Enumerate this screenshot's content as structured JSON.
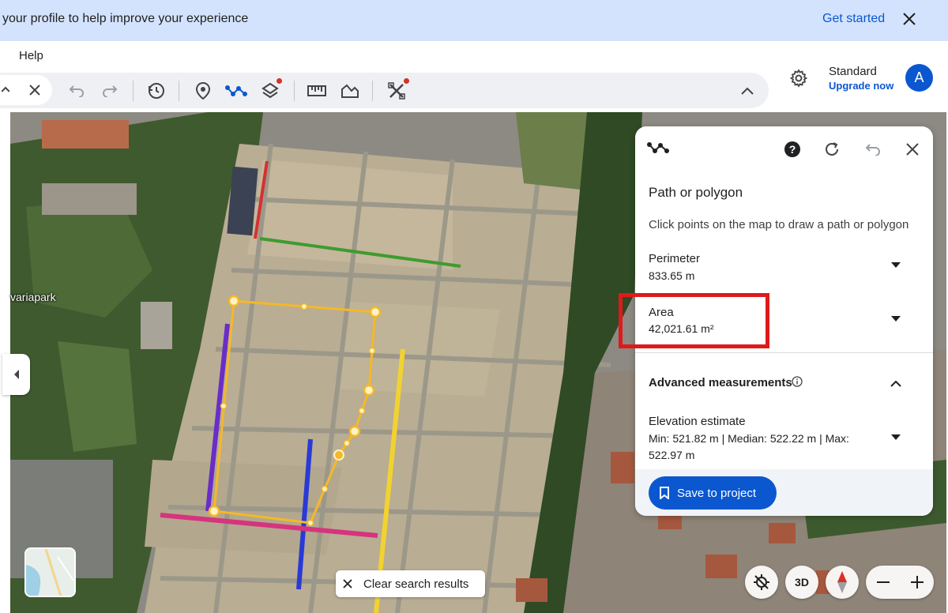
{
  "banner": {
    "text": "your profile to help improve your experience",
    "cta": "Get started"
  },
  "menu": {
    "help": "Help"
  },
  "account": {
    "plan": "Standard",
    "upgrade": "Upgrade now",
    "avatar_initial": "A"
  },
  "map": {
    "place_label": "variapark"
  },
  "panel": {
    "title": "Path or polygon",
    "instructions": "Click points on the map to draw a path or polygon",
    "perimeter_label": "Perimeter",
    "perimeter_value": "833.65 m",
    "area_label": "Area",
    "area_value": "42,021.61 m²",
    "advanced_heading": "Advanced measurements",
    "elevation_label": "Elevation estimate",
    "elevation_value": "Min: 521.82 m | Median: 522.22 m | Max: 522.97 m",
    "save_button": "Save to project"
  },
  "controls": {
    "clear_search": "Clear search results",
    "three_d": "3D"
  },
  "colors": {
    "accent": "#0b57d0",
    "banner": "#d3e3fd",
    "highlight": "#e0191b",
    "polygon": "#f6b828"
  }
}
